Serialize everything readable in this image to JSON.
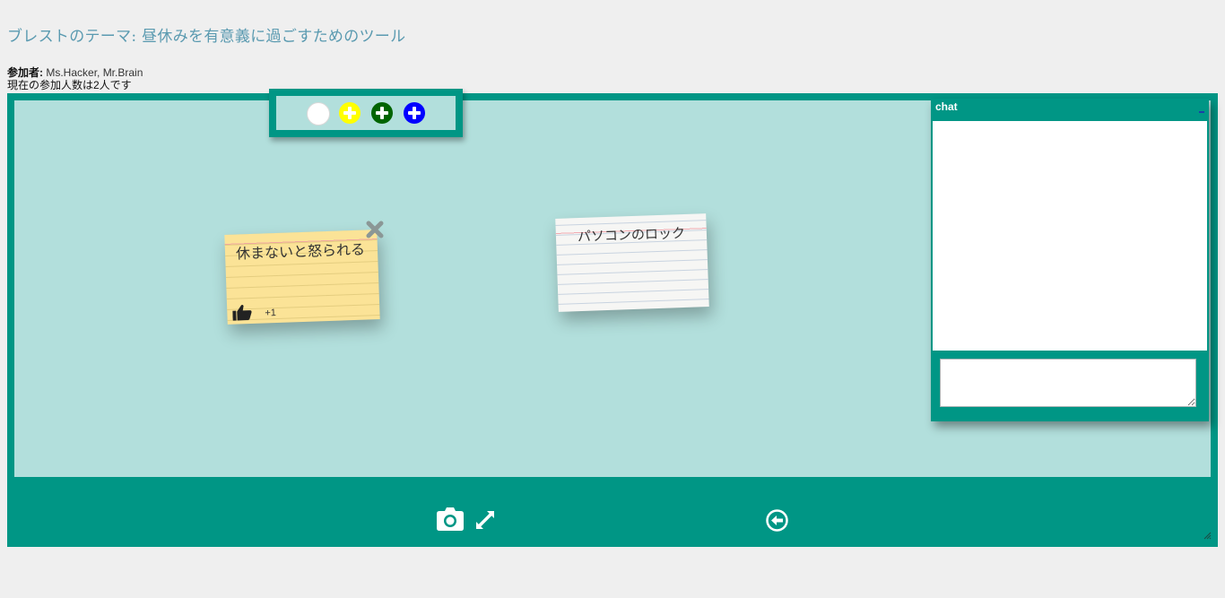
{
  "header": {
    "title": "ブレストのテーマ:  昼休みを有意義に過ごすためのツール",
    "participants_label": "参加者:",
    "participants_names": "Ms.Hacker, Mr.Brain",
    "participant_count_text": "現在の参加人数は2人です"
  },
  "toolbar": {
    "add_buttons": [
      {
        "name": "add-white-note-button",
        "color": "#ffffff"
      },
      {
        "name": "add-yellow-note-button",
        "color": "#ffff00"
      },
      {
        "name": "add-green-note-button",
        "color": "#006400"
      },
      {
        "name": "add-blue-note-button",
        "color": "#0000ff"
      }
    ],
    "icon": "plus-circle-icon"
  },
  "notes": [
    {
      "text": "休まないと怒られる",
      "color": "#fbe397",
      "vote_label": "+1",
      "like_icon": "thumbs-up-icon",
      "delete_icon": "close-icon"
    },
    {
      "text": "パソコンのロック",
      "color": "#f6f6f4"
    }
  ],
  "chat": {
    "title": "chat",
    "input_value": ""
  },
  "footer": {
    "icons": [
      "camera-icon",
      "expand-icon",
      "exit-icon"
    ]
  },
  "colors": {
    "frame": "#009685",
    "board": "#b2dfdc",
    "page_bg": "#efefef",
    "title_text": "#5a9ab0"
  }
}
